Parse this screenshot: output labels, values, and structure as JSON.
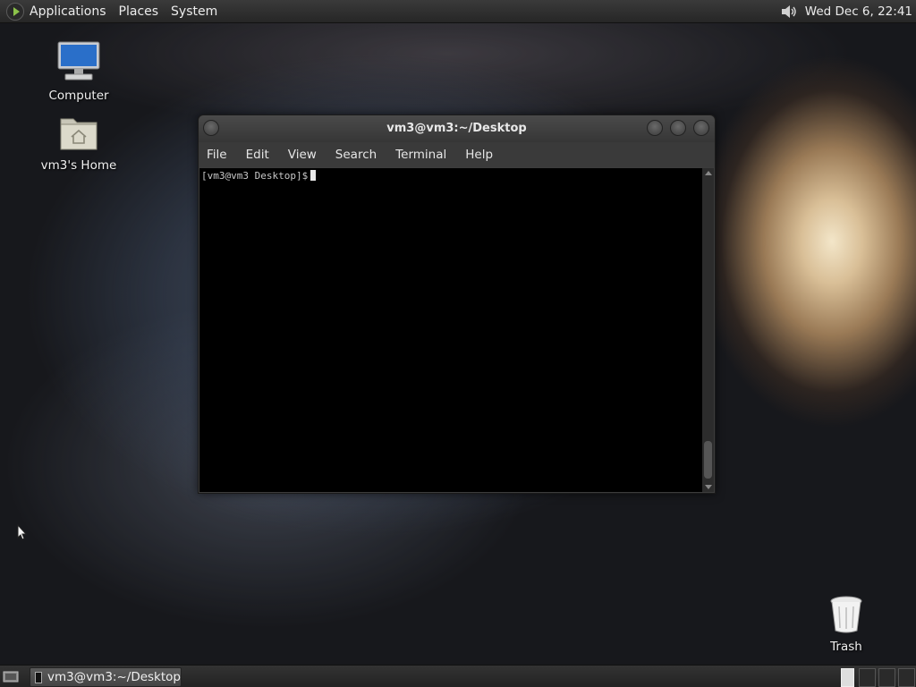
{
  "top_panel": {
    "menus": [
      "Applications",
      "Places",
      "System"
    ],
    "clock": "Wed Dec  6, 22:41",
    "icons": {
      "menu": "distro-logo-icon",
      "volume": "speaker-icon"
    }
  },
  "desktop": {
    "icons": [
      {
        "label": "Computer",
        "icon": "computer-icon"
      },
      {
        "label": "vm3's Home",
        "icon": "home-folder-icon"
      },
      {
        "label": "Trash",
        "icon": "trash-icon"
      }
    ]
  },
  "terminal": {
    "title": "vm3@vm3:~/Desktop",
    "menu": [
      "File",
      "Edit",
      "View",
      "Search",
      "Terminal",
      "Help"
    ],
    "prompt": "[vm3@vm3 Desktop]$"
  },
  "bottom_panel": {
    "task_label": "vm3@vm3:~/Desktop"
  },
  "colors": {
    "terminal_bg": "#000000",
    "panel_bg": "#2b2b2b"
  }
}
